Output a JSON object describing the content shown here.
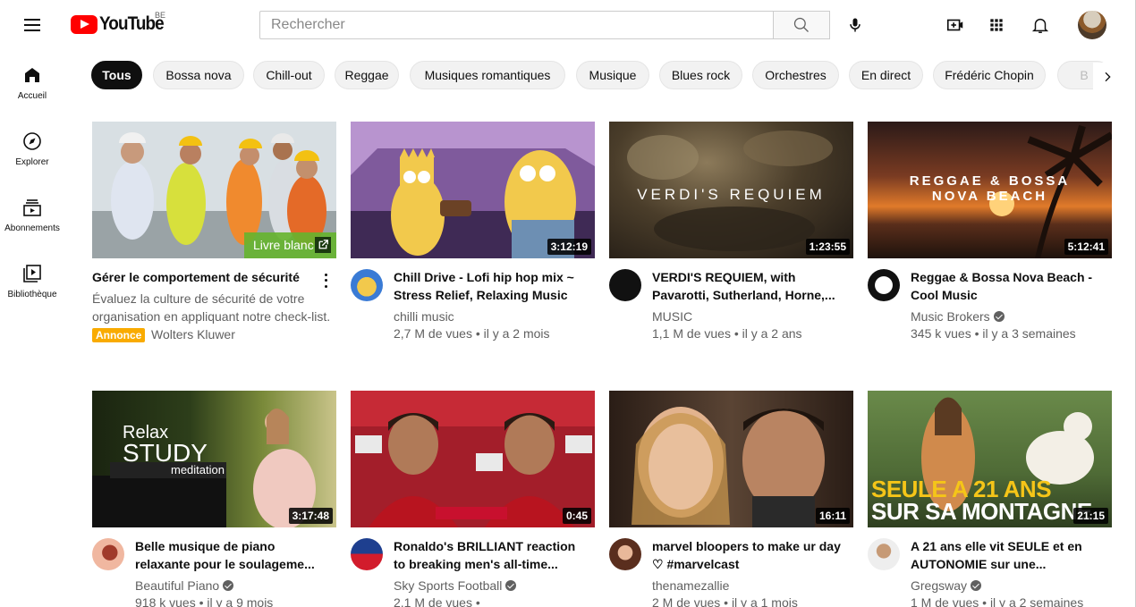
{
  "header": {
    "logo_text": "YouTube",
    "country_code": "BE",
    "search_placeholder": "Rechercher",
    "icons": [
      "menu-icon",
      "search-icon",
      "mic-icon",
      "create-video-icon",
      "apps-icon",
      "notifications-icon"
    ]
  },
  "sidebar": {
    "items": [
      {
        "label": "Accueil",
        "icon": "home-icon"
      },
      {
        "label": "Explorer",
        "icon": "compass-icon"
      },
      {
        "label": "Abonnements",
        "icon": "subscriptions-icon"
      },
      {
        "label": "Bibliothèque",
        "icon": "library-icon"
      }
    ]
  },
  "chips": [
    "Tous",
    "Bossa nova",
    "Chill-out",
    "Reggae",
    "Musiques romantiques",
    "Musique",
    "Blues rock",
    "Orchestres",
    "En direct",
    "Frédéric Chopin",
    "B"
  ],
  "ad": {
    "title": "Gérer le comportement de sécurité",
    "description": "Évaluez la culture de sécurité de votre organisation en appliquant notre check-list.",
    "badge": "Annonce",
    "advertiser": "Wolters Kluwer",
    "cta": "Livre blanc"
  },
  "videos": [
    {
      "title": "Chill Drive - Lofi hip hop mix ~ Stress Relief, Relaxing Music",
      "channel": "chilli music",
      "verified": false,
      "meta": "2,7 M de vues • il y a 2 mois",
      "duration": "3:12:19"
    },
    {
      "title": "VERDI'S REQUIEM, with Pavarotti, Sutherland, Horne,...",
      "channel": "MUSIC",
      "verified": false,
      "meta": "1,1 M de vues • il y a 2 ans",
      "duration": "1:23:55",
      "thumb_text": "VERDI'S REQUIEM"
    },
    {
      "title": "Reggae & Bossa Nova Beach - Cool Music",
      "channel": "Music Brokers",
      "verified": true,
      "meta": "345 k vues • il y a 3 semaines",
      "duration": "5:12:41",
      "thumb_text": "REGGAE & BOSSA NOVA BEACH"
    },
    {
      "title": "Belle musique de piano relaxante pour le soulageme...",
      "channel": "Beautiful Piano",
      "verified": true,
      "meta": "918 k vues • il y a 9 mois",
      "duration": "3:17:48",
      "thumb_text_1": "Relax",
      "thumb_text_2": "STUDY",
      "thumb_text_3": "meditation"
    },
    {
      "title": "Ronaldo's BRILLIANT reaction to breaking men's all-time...",
      "channel": "Sky Sports Football",
      "verified": true,
      "meta": "2,1 M de vues •",
      "duration": "0:45"
    },
    {
      "title": "marvel bloopers to make ur day ♡ #marvelcast",
      "channel": "thenamezallie",
      "verified": false,
      "meta": "2 M de vues • il y a 1 mois",
      "duration": "16:11"
    },
    {
      "title": "A 21 ans elle vit SEULE et en AUTONOMIE sur une...",
      "channel": "Gregsway",
      "verified": true,
      "meta": "1 M de vues • il y a 2 semaines",
      "duration": "21:15",
      "thumb_text_1": "SEULE A 21 ANS",
      "thumb_text_2": "SUR SA MONTAGNE"
    }
  ]
}
